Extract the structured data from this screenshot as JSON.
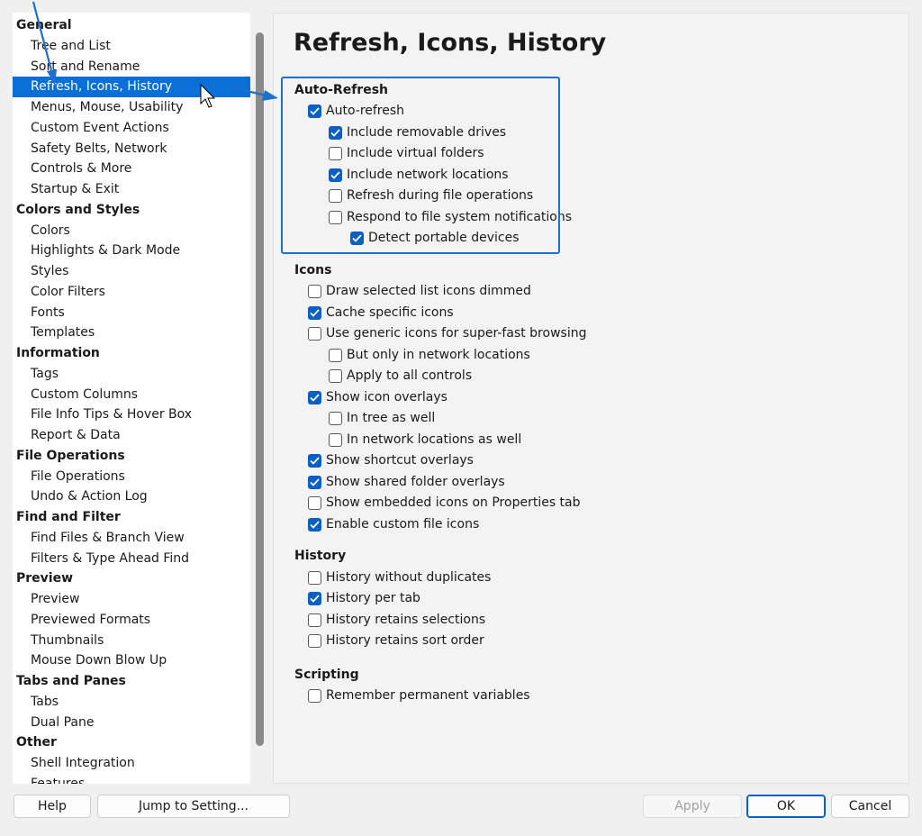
{
  "nav": {
    "rows": [
      {
        "type": "head",
        "label": "General"
      },
      {
        "type": "item",
        "label": "Tree and List"
      },
      {
        "type": "item",
        "label": "Sort and Rename"
      },
      {
        "type": "item",
        "label": "Refresh, Icons, History",
        "selected": true
      },
      {
        "type": "item",
        "label": "Menus, Mouse, Usability"
      },
      {
        "type": "item",
        "label": "Custom Event Actions"
      },
      {
        "type": "item",
        "label": "Safety Belts, Network"
      },
      {
        "type": "item",
        "label": "Controls & More"
      },
      {
        "type": "item",
        "label": "Startup & Exit"
      },
      {
        "type": "head",
        "label": "Colors and Styles"
      },
      {
        "type": "item",
        "label": "Colors"
      },
      {
        "type": "item",
        "label": "Highlights & Dark Mode"
      },
      {
        "type": "item",
        "label": "Styles"
      },
      {
        "type": "item",
        "label": "Color Filters"
      },
      {
        "type": "item",
        "label": "Fonts"
      },
      {
        "type": "item",
        "label": "Templates"
      },
      {
        "type": "head",
        "label": "Information"
      },
      {
        "type": "item",
        "label": "Tags"
      },
      {
        "type": "item",
        "label": "Custom Columns"
      },
      {
        "type": "item",
        "label": "File Info Tips & Hover Box"
      },
      {
        "type": "item",
        "label": "Report & Data"
      },
      {
        "type": "head",
        "label": "File Operations"
      },
      {
        "type": "item",
        "label": "File Operations"
      },
      {
        "type": "item",
        "label": "Undo & Action Log"
      },
      {
        "type": "head",
        "label": "Find and Filter"
      },
      {
        "type": "item",
        "label": "Find Files & Branch View"
      },
      {
        "type": "item",
        "label": "Filters & Type Ahead Find"
      },
      {
        "type": "head",
        "label": "Preview"
      },
      {
        "type": "item",
        "label": "Preview"
      },
      {
        "type": "item",
        "label": "Previewed Formats"
      },
      {
        "type": "item",
        "label": "Thumbnails"
      },
      {
        "type": "item",
        "label": "Mouse Down Blow Up"
      },
      {
        "type": "head",
        "label": "Tabs and Panes"
      },
      {
        "type": "item",
        "label": "Tabs"
      },
      {
        "type": "item",
        "label": "Dual Pane"
      },
      {
        "type": "head",
        "label": "Other"
      },
      {
        "type": "item",
        "label": "Shell Integration"
      },
      {
        "type": "item",
        "label": "Features"
      }
    ]
  },
  "page": {
    "title": "Refresh, Icons, History"
  },
  "sections": {
    "auto_refresh": "Auto-Refresh",
    "icons": "Icons",
    "history": "History",
    "scripting": "Scripting"
  },
  "options": {
    "auto_refresh": {
      "label": "Auto-refresh",
      "checked": true
    },
    "include_removable_drives": {
      "label": "Include removable drives",
      "checked": true
    },
    "include_virtual_folders": {
      "label": "Include virtual folders",
      "checked": false
    },
    "include_network_locations": {
      "label": "Include network locations",
      "checked": true
    },
    "refresh_during_file_ops": {
      "label": "Refresh during file operations",
      "checked": false
    },
    "respond_to_fs_notifications": {
      "label": "Respond to file system notifications",
      "checked": false
    },
    "detect_portable_devices": {
      "label": "Detect portable devices",
      "checked": true
    },
    "draw_selected_dimmed": {
      "label": "Draw selected list icons dimmed",
      "checked": false
    },
    "cache_specific_icons": {
      "label": "Cache specific icons",
      "checked": true
    },
    "use_generic_icons": {
      "label": "Use generic icons for super-fast browsing",
      "checked": false
    },
    "only_network_locations": {
      "label": "But only in network locations",
      "checked": false
    },
    "apply_to_all_controls": {
      "label": "Apply to all controls",
      "checked": false
    },
    "show_icon_overlays": {
      "label": "Show icon overlays",
      "checked": true
    },
    "in_tree_as_well": {
      "label": "In tree as well",
      "checked": false
    },
    "in_network_locations_as_well": {
      "label": "In network locations as well",
      "checked": false
    },
    "show_shortcut_overlays": {
      "label": "Show shortcut overlays",
      "checked": true
    },
    "show_shared_folder_overlays": {
      "label": "Show shared folder overlays",
      "checked": true
    },
    "show_embedded_icons": {
      "label": "Show embedded icons on Properties tab",
      "checked": false
    },
    "enable_custom_file_icons": {
      "label": "Enable custom file icons",
      "checked": true
    },
    "history_without_duplicates": {
      "label": "History without duplicates",
      "checked": false
    },
    "history_per_tab": {
      "label": "History per tab",
      "checked": true
    },
    "history_retains_selections": {
      "label": "History retains selections",
      "checked": false
    },
    "history_retains_sort_order": {
      "label": "History retains sort order",
      "checked": false
    },
    "remember_permanent_variables": {
      "label": "Remember permanent variables",
      "checked": false
    }
  },
  "footer": {
    "help": "Help",
    "jump": "Jump to Setting...",
    "apply": "Apply",
    "ok": "OK",
    "cancel": "Cancel"
  },
  "colors": {
    "accent": "#0a5fc4",
    "selection": "#0a6fd6",
    "annotation": "#1a6fd1"
  }
}
